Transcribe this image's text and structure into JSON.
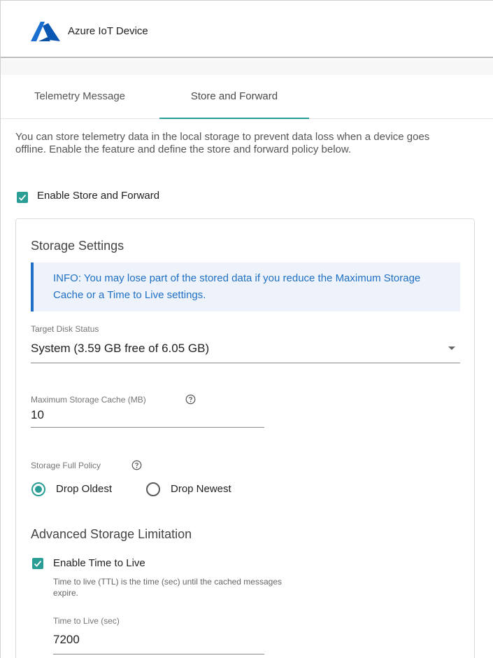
{
  "header": {
    "app_title": "Azure IoT Device",
    "logo_icon": "azure-logo-icon"
  },
  "tabs": [
    {
      "label": "Telemetry Message",
      "active": false
    },
    {
      "label": "Store and Forward",
      "active": true
    }
  ],
  "intro": "You can store telemetry data in the local storage to prevent data loss when a device goes offline. Enable the feature and define the store and forward policy below.",
  "enable_store_forward": {
    "label": "Enable Store and Forward",
    "checked": true
  },
  "storage_settings": {
    "title": "Storage Settings",
    "info": "INFO: You may lose part of the stored data if you reduce the Maximum Storage Cache or a Time to Live settings.",
    "target_disk": {
      "label": "Target Disk Status",
      "value": "System (3.59 GB free of 6.05 GB)"
    },
    "max_cache": {
      "label": "Maximum Storage Cache (MB)",
      "value": "10"
    },
    "full_policy": {
      "label": "Storage Full Policy",
      "options": [
        {
          "label": "Drop Oldest",
          "selected": true
        },
        {
          "label": "Drop Newest",
          "selected": false
        }
      ]
    }
  },
  "advanced": {
    "title": "Advanced Storage Limitation",
    "enable_ttl": {
      "label": "Enable Time to Live",
      "checked": true
    },
    "ttl_hint": "Time to live (TTL) is the time (sec) until the cached messages expire.",
    "ttl": {
      "label": "Time to Live (sec)",
      "value": "7200"
    }
  },
  "colors": {
    "accent": "#2a9d95",
    "info_text": "#1e6fc5",
    "info_bg": "#eef3fb",
    "azure_blue": "#0a6ed1"
  }
}
